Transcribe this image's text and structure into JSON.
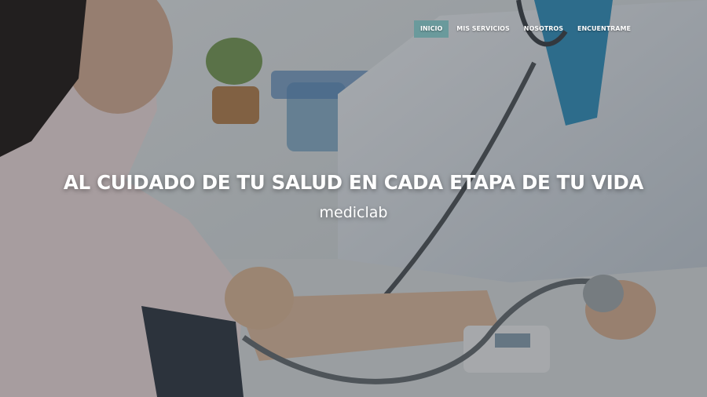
{
  "nav": {
    "items": [
      {
        "label": "INICIO",
        "active": true
      },
      {
        "label": "MIS SERVICIOS",
        "active": false
      },
      {
        "label": "NOSOTROS",
        "active": false
      },
      {
        "label": "ENCUENTRAME",
        "active": false
      }
    ]
  },
  "hero": {
    "headline": "AL CUIDADO DE TU SALUD EN CADA ETAPA DE TU VIDA",
    "subtitle": "mediclab",
    "image_subject": "doctor-measuring-blood-pressure-photo"
  },
  "colors": {
    "nav_active_bg": "#6a9a9c",
    "text": "#ffffff"
  }
}
